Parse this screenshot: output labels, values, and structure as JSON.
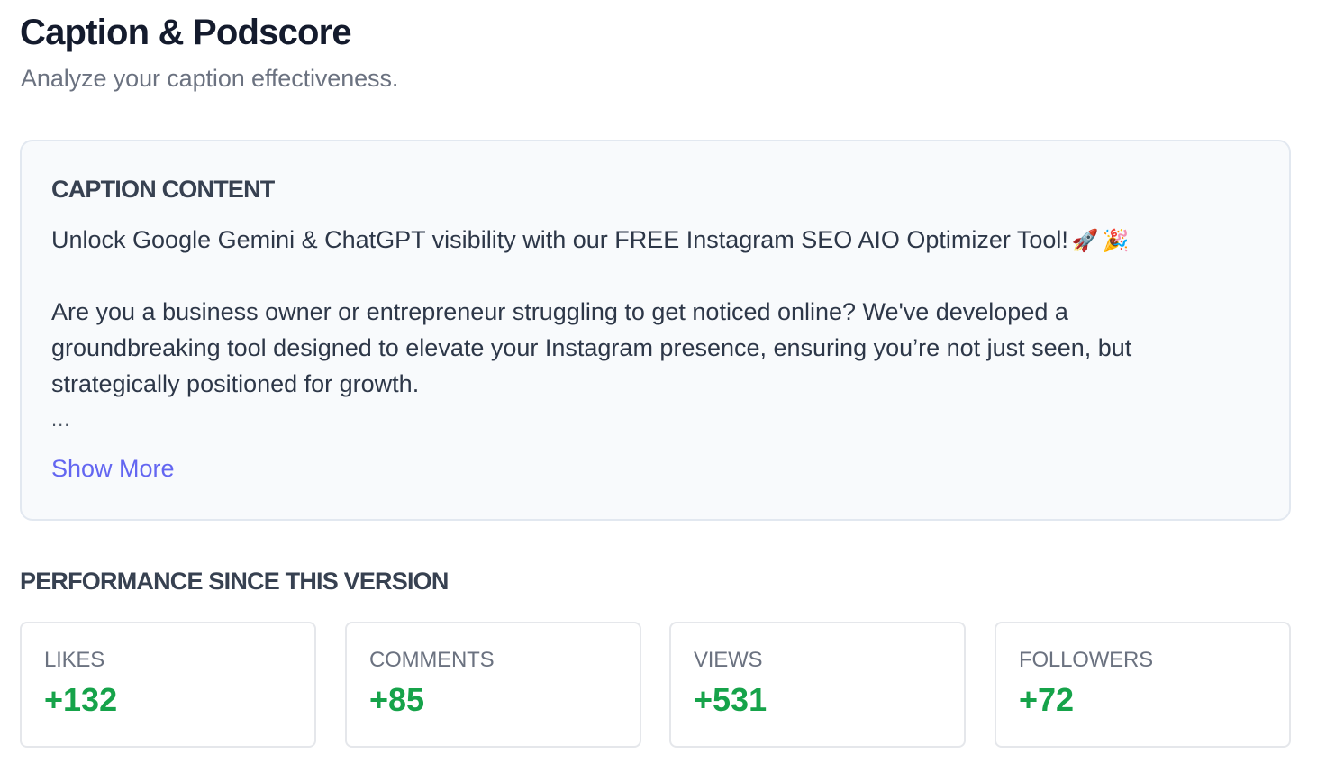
{
  "header": {
    "title": "Caption & Podscore",
    "subtitle": "Analyze your caption effectiveness."
  },
  "caption": {
    "heading": "CAPTION CONTENT",
    "first_line": "Unlock Google Gemini & ChatGPT visibility with our FREE Instagram SEO AIO Optimizer Tool!",
    "emojis": [
      "rocket-emoji",
      "party-popper-emoji"
    ],
    "paragraph_lines": [
      "Are you a business owner or entrepreneur struggling to get noticed online? We've developed a",
      "groundbreaking tool designed to elevate your Instagram presence, ensuring you’re not just seen, but",
      "strategically positioned for growth."
    ],
    "ellipsis": "...",
    "show_more_label": "Show More"
  },
  "performance": {
    "heading": "PERFORMANCE SINCE THIS VERSION",
    "stats": [
      {
        "label": "LIKES",
        "value": "+132"
      },
      {
        "label": "COMMENTS",
        "value": "+85"
      },
      {
        "label": "VIEWS",
        "value": "+531"
      },
      {
        "label": "FOLLOWERS",
        "value": "+72"
      }
    ]
  },
  "colors": {
    "accent": "#6366f1",
    "positive": "#16a34a",
    "card_bg": "#f8fafc"
  }
}
